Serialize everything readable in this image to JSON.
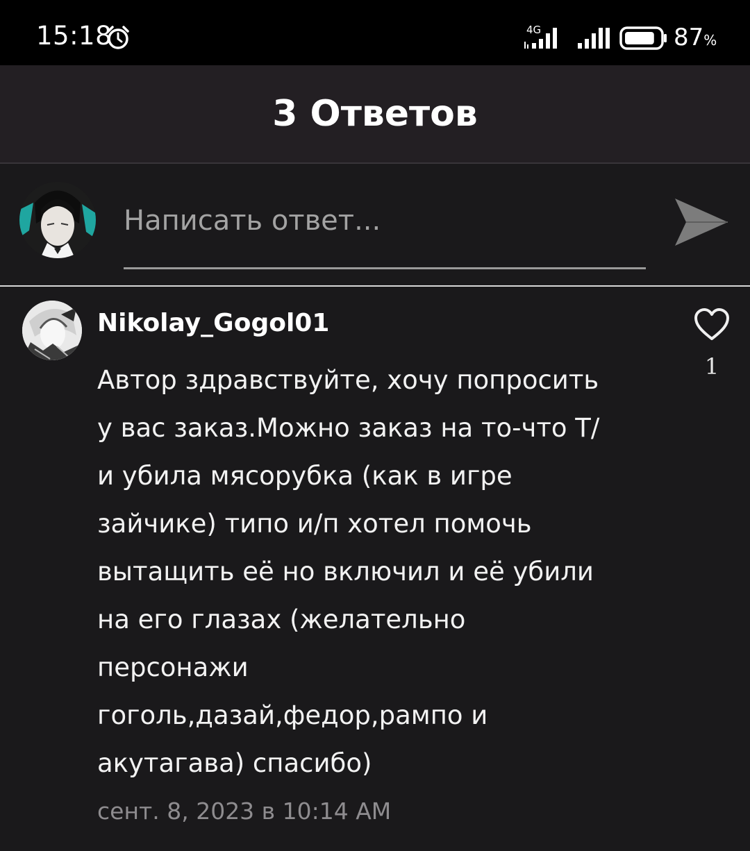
{
  "status_bar": {
    "time": "15:18",
    "network": "4G",
    "battery_percent": "87",
    "battery_unit": "%",
    "battery_level": 0.87,
    "icons": [
      "alarm-icon",
      "4g-signal-icon",
      "signal-icon",
      "battery-icon"
    ]
  },
  "header": {
    "title": "3 Ответов"
  },
  "composer": {
    "placeholder": "Написать ответ...",
    "value": "",
    "send_icon": "send-icon"
  },
  "comment": {
    "author": "Nikolay_Gogol01",
    "body_lines": [
      "Автор здравствуйте, хочу попросить",
      "у вас заказ.Можно заказ на то-что Т/",
      "и убила мясорубка (как в игре",
      "зайчике) типо и/п хотел помочь",
      "вытащить её но включил и её убили",
      "на его глазах (желательно",
      "персонажи",
      "гоголь,дазай,федор,рампо и",
      "акутагава) спасибо)"
    ],
    "date": "сент. 8, 2023 в 10:14 AM",
    "like_icon": "heart-outline-icon",
    "likes": "1"
  },
  "colors": {
    "status_bar_bg": "#000000",
    "header_bg": "#231f23",
    "page_bg": "#1a191b",
    "text_primary": "#ffffff",
    "text_muted": "#8e8c8f",
    "send_icon": "#7c7c7c"
  }
}
